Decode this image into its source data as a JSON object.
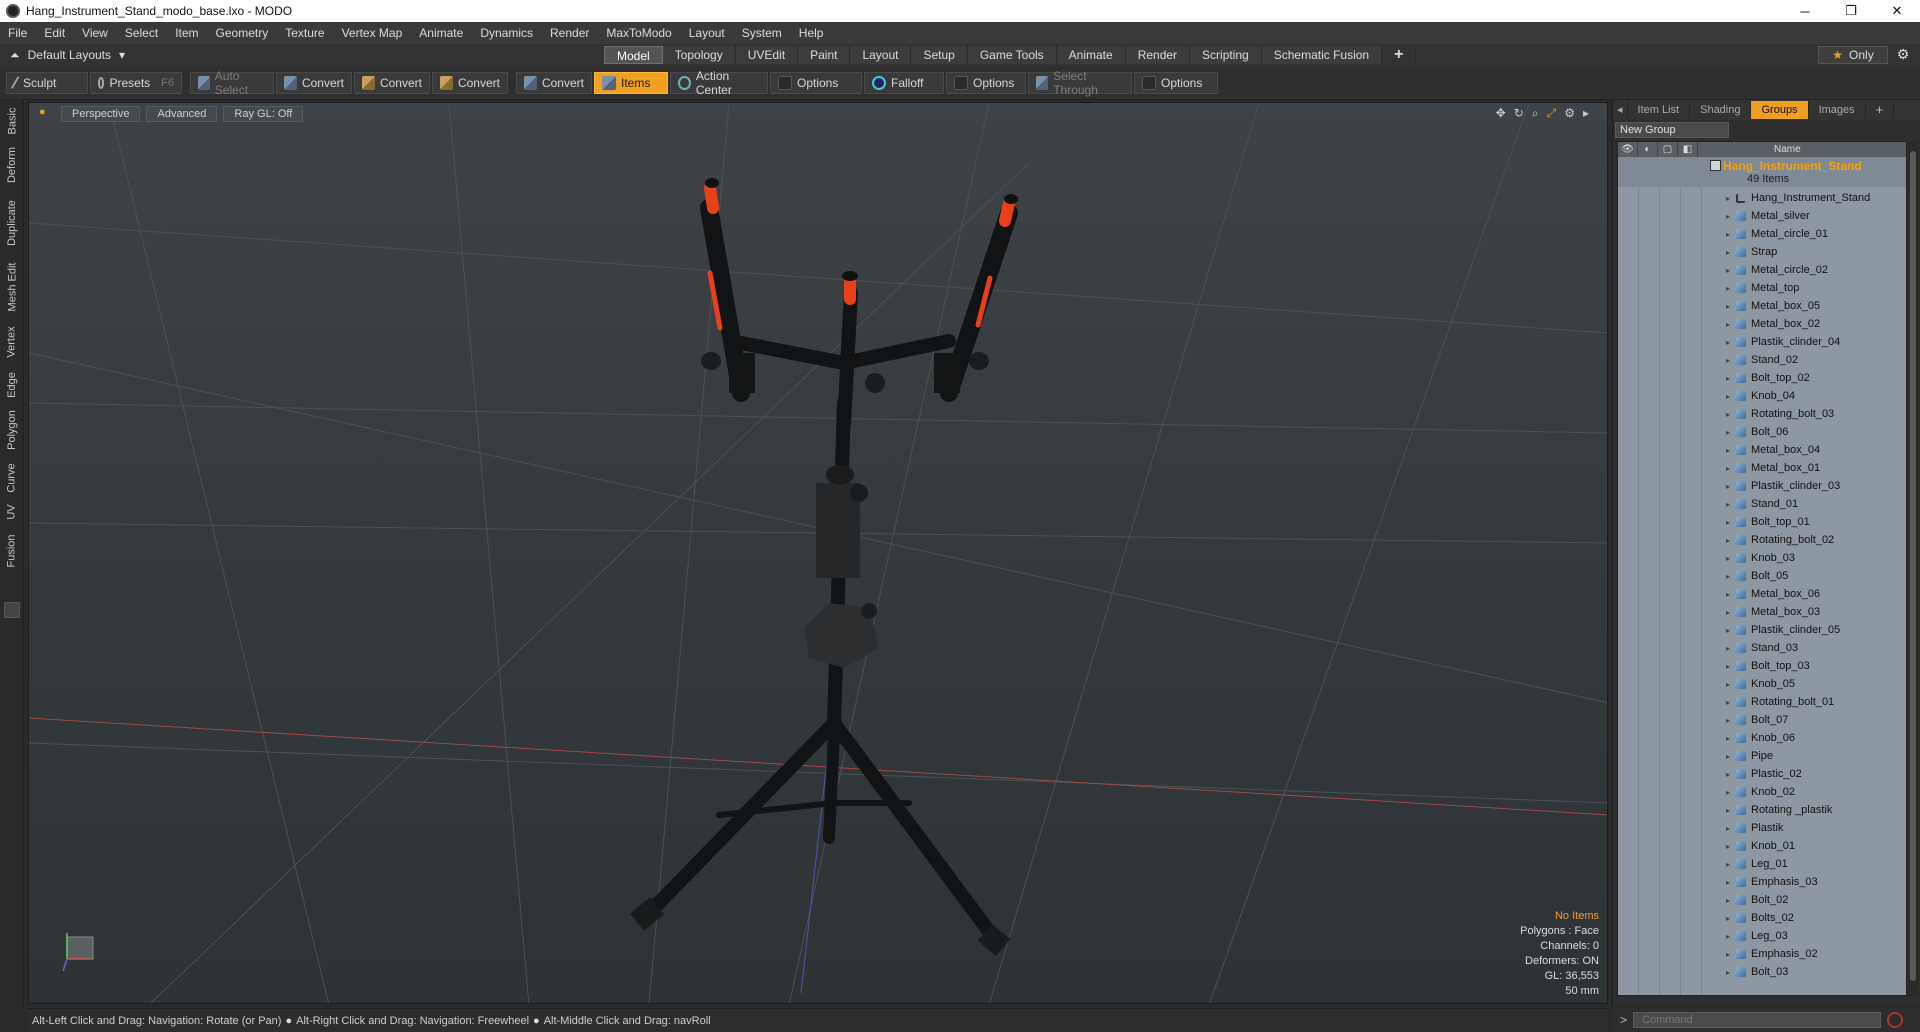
{
  "window": {
    "title": "Hang_Instrument_Stand_modo_base.lxo - MODO",
    "minimize": "─",
    "maximize": "❐",
    "close": "✕"
  },
  "menu": [
    "File",
    "Edit",
    "View",
    "Select",
    "Item",
    "Geometry",
    "Texture",
    "Vertex Map",
    "Animate",
    "Dynamics",
    "Render",
    "MaxToModo",
    "Layout",
    "System",
    "Help"
  ],
  "layoutbar": {
    "layouts_label": "Default Layouts",
    "tabs": [
      "Model",
      "Topology",
      "UVEdit",
      "Paint",
      "Layout",
      "Setup",
      "Game Tools",
      "Animate",
      "Render",
      "Scripting",
      "Schematic Fusion"
    ],
    "active_tab": "Model",
    "plus": "+",
    "only_label": "Only",
    "star": "★"
  },
  "toolbar": {
    "sculpt": "Sculpt",
    "presets": "Presets",
    "presets_key": "F6",
    "auto_select": "Auto Select",
    "convert1": "Convert",
    "convert2": "Convert",
    "convert3": "Convert",
    "convert4": "Convert",
    "items": "Items",
    "action_center": "Action Center",
    "options1": "Options",
    "falloff": "Falloff",
    "options2": "Options",
    "select_through": "Select Through",
    "options3": "Options"
  },
  "left_tabs": [
    "Basic",
    "Deform",
    "Duplicate",
    "Mesh Edit",
    "Vertex",
    "Edge",
    "Polygon",
    "Curve",
    "UV",
    "Fusion"
  ],
  "viewport": {
    "view": "Perspective",
    "shading": "Advanced",
    "raygl": "Ray GL: Off",
    "info": {
      "no_items": "No Items",
      "polygons": "Polygons : Face",
      "channels": "Channels: 0",
      "deformers": "Deformers: ON",
      "gl": "GL: 36,553",
      "scale": "50 mm"
    }
  },
  "right_panel": {
    "tabs": [
      "Item List",
      "Shading",
      "Groups",
      "Images"
    ],
    "active_tab": "Groups",
    "plus": "+",
    "new_group": "New Group",
    "name_header": "Name",
    "group_name": "Hang_Instrument_Stand",
    "group_count": "49 Items",
    "items": [
      "Hang_Instrument_Stand",
      "Metal_silver",
      "Metal_circle_01",
      "Strap",
      "Metal_circle_02",
      "Metal_top",
      "Metal_box_05",
      "Metal_box_02",
      "Plastik_clinder_04",
      "Stand_02",
      "Bolt_top_02",
      "Knob_04",
      "Rotating_bolt_03",
      "Bolt_06",
      "Metal_box_04",
      "Metal_box_01",
      "Plastik_clinder_03",
      "Stand_01",
      "Bolt_top_01",
      "Rotating_bolt_02",
      "Knob_03",
      "Bolt_05",
      "Metal_box_06",
      "Metal_box_03",
      "Plastik_clinder_05",
      "Stand_03",
      "Bolt_top_03",
      "Knob_05",
      "Rotating_bolt_01",
      "Bolt_07",
      "Knob_06",
      "Pipe",
      "Plastic_02",
      "Knob_02",
      "Rotating _plastik",
      "Plastik",
      "Knob_01",
      "Leg_01",
      "Emphasis_03",
      "Bolt_02",
      "Bolts_02",
      "Leg_03",
      "Emphasis_02",
      "Bolt_03"
    ]
  },
  "status": {
    "hint1": "Alt-Left Click and Drag: Navigation: Rotate (or Pan)",
    "hint2": "Alt-Right Click and Drag: Navigation: Freewheel",
    "hint3": "Alt-Middle Click and Drag: navRoll",
    "bullet": "●",
    "command_placeholder": "Command"
  }
}
